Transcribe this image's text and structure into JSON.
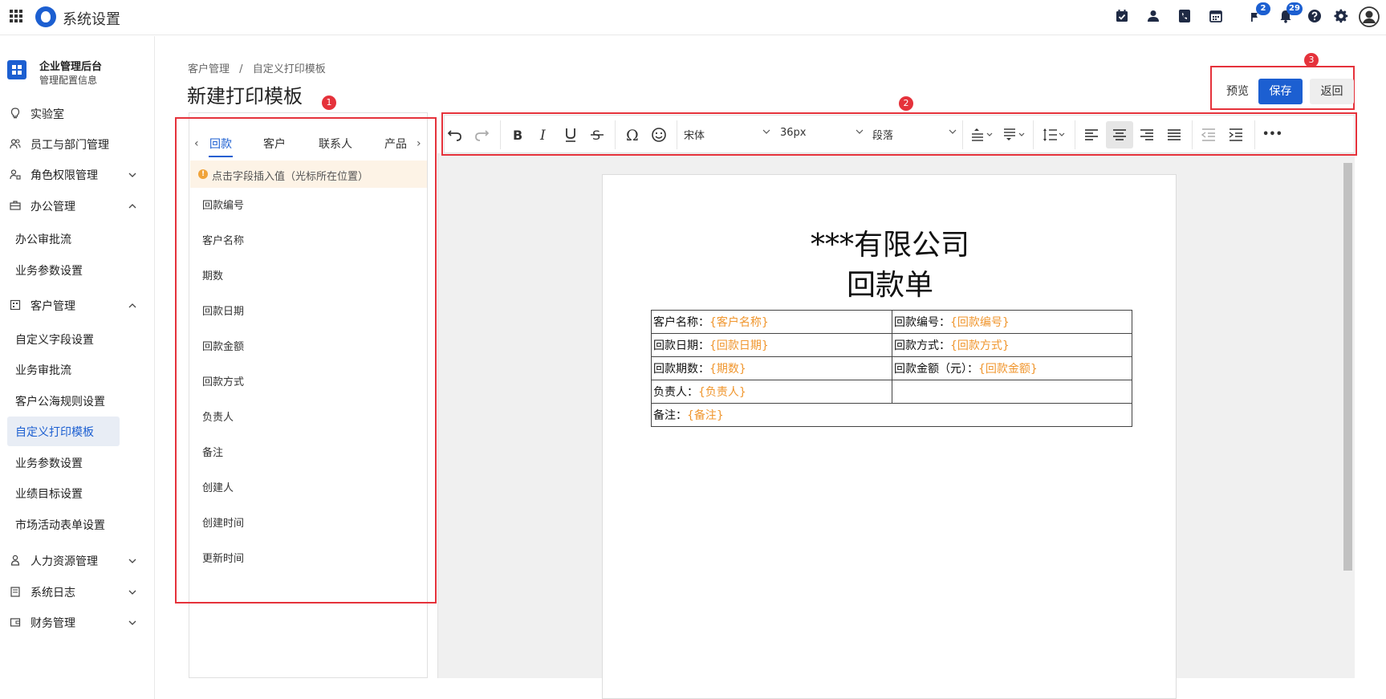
{
  "header": {
    "app_title": "系统设置",
    "badges": {
      "flag": "2",
      "bell": "29"
    }
  },
  "sidebar": {
    "brand_title": "企业管理后台",
    "brand_subtitle": "管理配置信息",
    "items": [
      {
        "label": "实验室",
        "icon": "bulb-icon"
      },
      {
        "label": "员工与部门管理",
        "icon": "users-icon"
      },
      {
        "label": "角色权限管理",
        "icon": "user-lock-icon",
        "expanded": false
      },
      {
        "label": "办公管理",
        "icon": "briefcase-icon",
        "expanded": true
      },
      {
        "label": "客户管理",
        "icon": "building-icon",
        "expanded": true
      },
      {
        "label": "人力资源管理",
        "icon": "person-icon",
        "expanded": false
      },
      {
        "label": "系统日志",
        "icon": "log-icon",
        "expanded": false
      },
      {
        "label": "财务管理",
        "icon": "wallet-icon",
        "expanded": false
      }
    ],
    "office_sub": [
      "办公审批流",
      "业务参数设置"
    ],
    "customer_sub": [
      "自定义字段设置",
      "业务审批流",
      "客户公海规则设置",
      "自定义打印模板",
      "业务参数设置",
      "业绩目标设置",
      "市场活动表单设置"
    ],
    "active_item": "自定义打印模板"
  },
  "breadcrumb": [
    "客户管理",
    "/",
    "自定义打印模板"
  ],
  "page_title": "新建打印模板",
  "annotations": [
    "1",
    "2",
    "3"
  ],
  "actions": {
    "preview": "预览",
    "save": "保存",
    "back": "返回"
  },
  "field_panel": {
    "tabs": [
      "回款",
      "客户",
      "联系人",
      "产品"
    ],
    "active_tab": "回款",
    "prev_arrow": "‹",
    "next_arrow": "›",
    "hint": "点击字段插入值（光标所在位置）",
    "fields": [
      "回款编号",
      "客户名称",
      "期数",
      "回款日期",
      "回款金额",
      "回款方式",
      "负责人",
      "备注",
      "创建人",
      "创建时间",
      "更新时间"
    ]
  },
  "toolbar": {
    "font_family": "宋体",
    "font_size": "36px",
    "block_format": "段落",
    "more": "•••"
  },
  "document": {
    "title_line1": "***有限公司",
    "title_line2": "回款单",
    "rows": [
      {
        "l_label": "客户名称：",
        "l_value": "{客户名称}",
        "r_label": "回款编号：",
        "r_value": "{回款编号}"
      },
      {
        "l_label": "回款日期：",
        "l_value": "{回款日期}",
        "r_label": "回款方式：",
        "r_value": "{回款方式}"
      },
      {
        "l_label": "回款期数：",
        "l_value": "{期数}",
        "r_label": "回款金额（元）：",
        "r_value": "{回款金额}"
      },
      {
        "l_label": "负责人：",
        "l_value": "{负责人}",
        "r_label": "",
        "r_value": ""
      }
    ],
    "note_label": "备注：",
    "note_value": "{备注}"
  },
  "colors": {
    "primary": "#1c5fd1",
    "annotation_red": "#e5323b",
    "placeholder_orange": "#f0962e",
    "hint_bg": "#fdf3e6"
  }
}
